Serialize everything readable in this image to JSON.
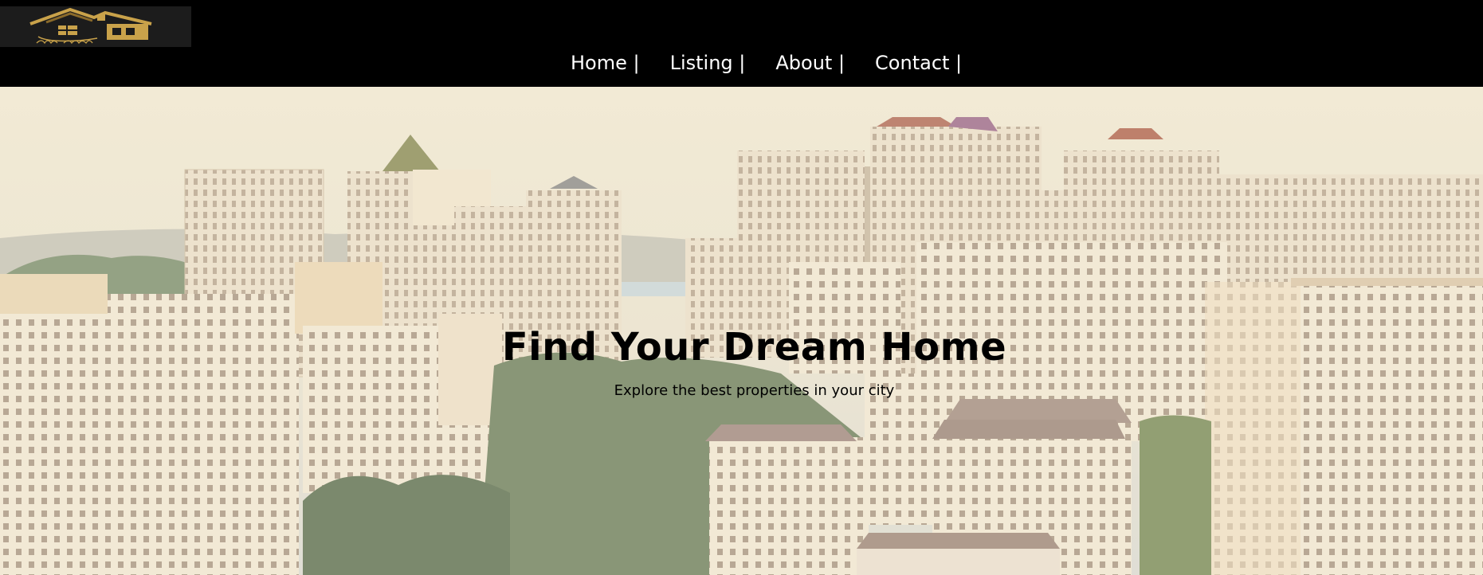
{
  "logo": {
    "script_text": "Tune Wright",
    "icon": "house-roof-icon",
    "colors": {
      "gold": "#c9a24a",
      "background": "#1c1c1c"
    }
  },
  "nav": {
    "items": [
      {
        "label": "Home |"
      },
      {
        "label": "Listing |"
      },
      {
        "label": "About |"
      },
      {
        "label": "Contact |"
      }
    ]
  },
  "hero": {
    "title": "Find Your Dream Home",
    "subtitle": "Explore the best properties in your city",
    "background_image": "city-skyline-photo"
  },
  "colors": {
    "header_bg": "#000000",
    "nav_text": "#ffffff",
    "hero_text": "#000000",
    "sky": "#eae0c8",
    "building": "#e6d6be"
  }
}
